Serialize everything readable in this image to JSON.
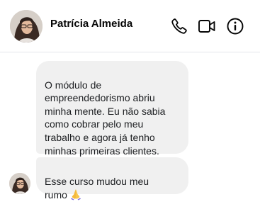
{
  "header": {
    "contact_name": "Patrícia Almeida",
    "avatar_alt": "Patrícia Almeida",
    "icons": [
      "phone-icon",
      "video-camera-icon",
      "info-icon"
    ]
  },
  "messages": [
    {
      "text": "O módulo de\nempreendedorismo abriu\nminha mente. Eu não sabia\ncomo cobrar pelo meu\ntrabalho e agora já tenho\nminhas primeiras clientes."
    },
    {
      "text": "Esse curso mudou meu\nrumo",
      "emoji": "praying-hands-emoji"
    }
  ],
  "colors": {
    "bubble_background": "#f0f0f0",
    "divider": "#e4e6eb",
    "text": "#050505"
  }
}
